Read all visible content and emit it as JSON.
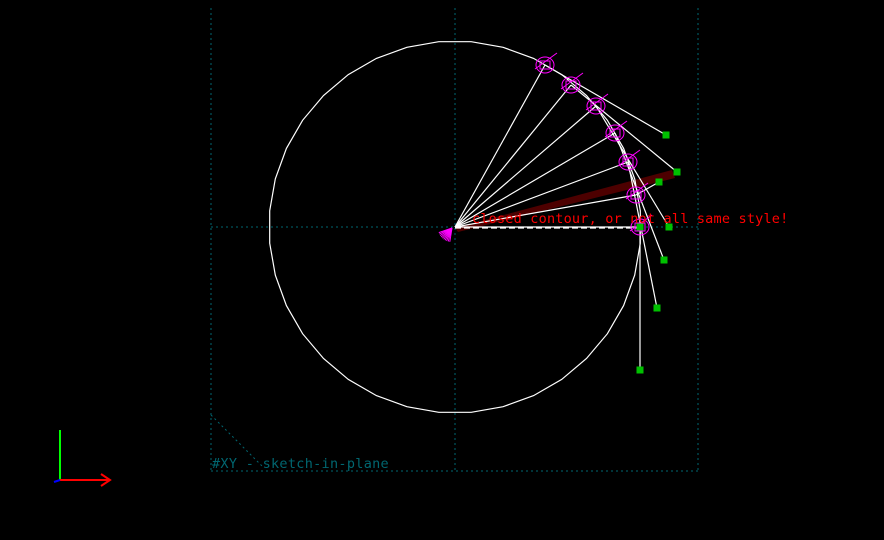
{
  "viewport": {
    "warning_text": "closed contour, or not all same style!",
    "workplane_label": "#XY - sketch-in-plane"
  },
  "colors": {
    "background": "#000000",
    "geometry": "#ffffff",
    "constraint": "#ff00ff",
    "point": "#00c000",
    "workplane": "#006670",
    "warning": "#ff0000",
    "warning_band": "#5a0000",
    "axis_x": "#ff0000",
    "axis_y": "#00ff00",
    "axis_z": "#0000ff"
  },
  "icons": {
    "axis_triad": "xyz-axis-triad-icon",
    "endpoint": "green-square-point-icon",
    "constraint": "magenta-constraint-glyph-icon"
  }
}
